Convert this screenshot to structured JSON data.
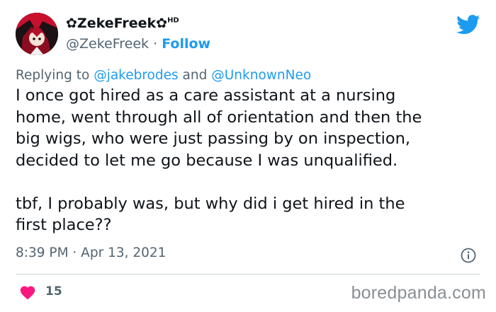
{
  "author": {
    "display_name": "✿ZekeFreek✿",
    "display_suffix": "HD",
    "handle": "@ZekeFreek",
    "separator": "·",
    "follow_label": "Follow"
  },
  "reply": {
    "prefix": "Replying to",
    "mention_1": "@jakebrodes",
    "conjunction": "and",
    "mention_2": "@UnknownNeo"
  },
  "tweet": {
    "text": "I once got hired as a care assistant at a nursing\nhome, went through all of orientation and then the\nbig wigs, who were just passing by on inspection,\ndecided to let me go because I was unqualified.\n\ntbf, I probably was, but why did i get hired in the\nfirst place??",
    "timestamp": "8:39 PM · Apr 13, 2021"
  },
  "engagement": {
    "likes": "15"
  },
  "watermark": "boredpanda.com",
  "icons": {
    "brand": "twitter-bird-icon",
    "info": "info-icon",
    "like": "heart-icon"
  },
  "colors": {
    "accent": "#1d9bf0",
    "secondary_text": "#536471",
    "heart": "#f91880"
  }
}
